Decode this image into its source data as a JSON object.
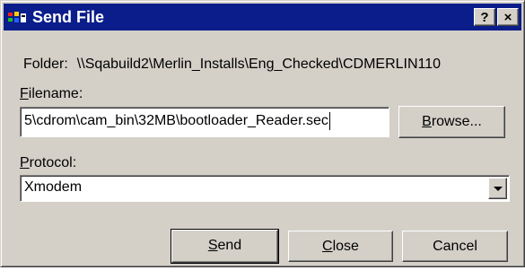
{
  "window": {
    "title": "Send File",
    "help_label": "?",
    "close_label": "×"
  },
  "folder": {
    "label": "Folder:",
    "path": "\\\\Sqabuild2\\Merlin_Installs\\Eng_Checked\\CDMERLIN110"
  },
  "filename": {
    "label": "Filename:",
    "value": "5\\cdrom\\cam_bin\\32MB\\bootloader_Reader.sec"
  },
  "browse_button": {
    "label": "Browse..."
  },
  "protocol": {
    "label": "Protocol:",
    "selected": "Xmodem"
  },
  "buttons": {
    "send": "Send",
    "close": "Close",
    "cancel": "Cancel"
  },
  "colors": {
    "titlebar": "#0a1d8a",
    "face": "#d4d0c8"
  }
}
